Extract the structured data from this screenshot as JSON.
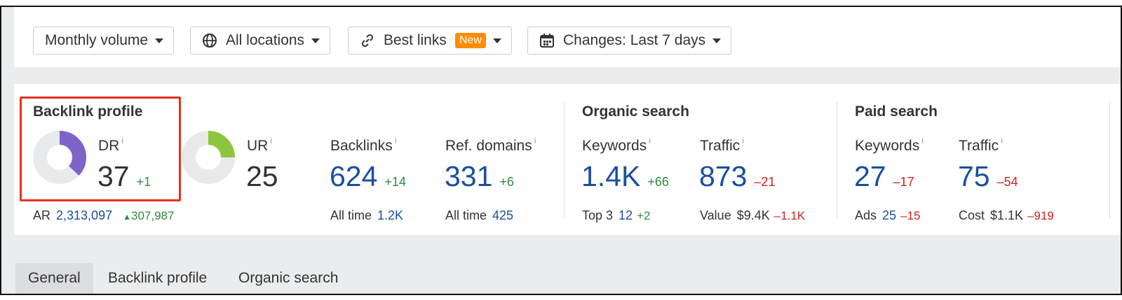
{
  "toolbar": {
    "volume_label": "Monthly volume",
    "locations_label": "All locations",
    "links_label": "Best links",
    "links_badge": "New",
    "changes_label": "Changes: Last 7 days"
  },
  "backlink_profile": {
    "title": "Backlink profile",
    "dr": {
      "label": "DR",
      "info": "i",
      "value": "37",
      "delta": "+1",
      "fraction": 0.37,
      "color": "#7e63c9"
    },
    "ur": {
      "label": "UR",
      "info": "i",
      "value": "25",
      "fraction": 0.25,
      "color": "#8cc63f"
    },
    "ar": {
      "label": "AR",
      "value": "2,313,097",
      "delta": "307,987"
    },
    "backlinks": {
      "label": "Backlinks",
      "info": "i",
      "value": "624",
      "delta": "+14",
      "sub_label": "All time",
      "sub_value": "1.2K"
    },
    "ref_domains": {
      "label": "Ref. domains",
      "info": "i",
      "value": "331",
      "delta": "+6",
      "sub_label": "All time",
      "sub_value": "425"
    }
  },
  "organic_search": {
    "title": "Organic search",
    "keywords": {
      "label": "Keywords",
      "info": "i",
      "value": "1.4K",
      "delta": "+66",
      "sub_label": "Top 3",
      "sub_value": "12",
      "sub_delta": "+2"
    },
    "traffic": {
      "label": "Traffic",
      "info": "i",
      "value": "873",
      "delta": "–21",
      "sub_label": "Value",
      "sub_value": "$9.4K",
      "sub_delta": "–1.1K"
    }
  },
  "paid_search": {
    "title": "Paid search",
    "keywords": {
      "label": "Keywords",
      "info": "i",
      "value": "27",
      "delta": "–17",
      "sub_label": "Ads",
      "sub_value": "25",
      "sub_delta": "–15"
    },
    "traffic": {
      "label": "Traffic",
      "info": "i",
      "value": "75",
      "delta": "–54",
      "sub_label": "Cost",
      "sub_value": "$1.1K",
      "sub_delta": "–919"
    }
  },
  "tabs": [
    {
      "label": "General",
      "active": true
    },
    {
      "label": "Backlink profile",
      "active": false
    },
    {
      "label": "Organic search",
      "active": false
    }
  ],
  "colors": {
    "accent_blue": "#1a4fa0",
    "positive": "#2e8b3e",
    "negative": "#d02020",
    "highlight": "#e53020",
    "badge": "#ff8c00"
  }
}
